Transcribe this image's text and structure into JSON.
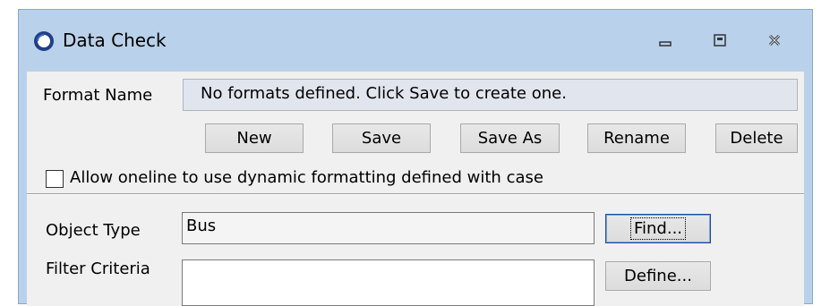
{
  "window": {
    "title": "Data Check",
    "controls": {
      "minimize": "minimize",
      "maximize": "maximize",
      "close": "close"
    }
  },
  "format": {
    "label": "Format Name",
    "value": "No formats defined.  Click Save to create one."
  },
  "buttons": {
    "new": "New",
    "save": "Save",
    "save_as": "Save As",
    "rename": "Rename",
    "delete": "Delete"
  },
  "dynamic_formatting": {
    "label": "Allow oneline to use dynamic formatting defined with case",
    "checked": false
  },
  "object_type": {
    "label": "Object Type",
    "value": "Bus",
    "find_button": "Find..."
  },
  "filter": {
    "label": "Filter Criteria",
    "value": "",
    "define_button": "Define..."
  },
  "colors": {
    "frame": "#b9d1ea",
    "body": "#f0f0f0",
    "readonly_field": "#e1e6ee"
  }
}
